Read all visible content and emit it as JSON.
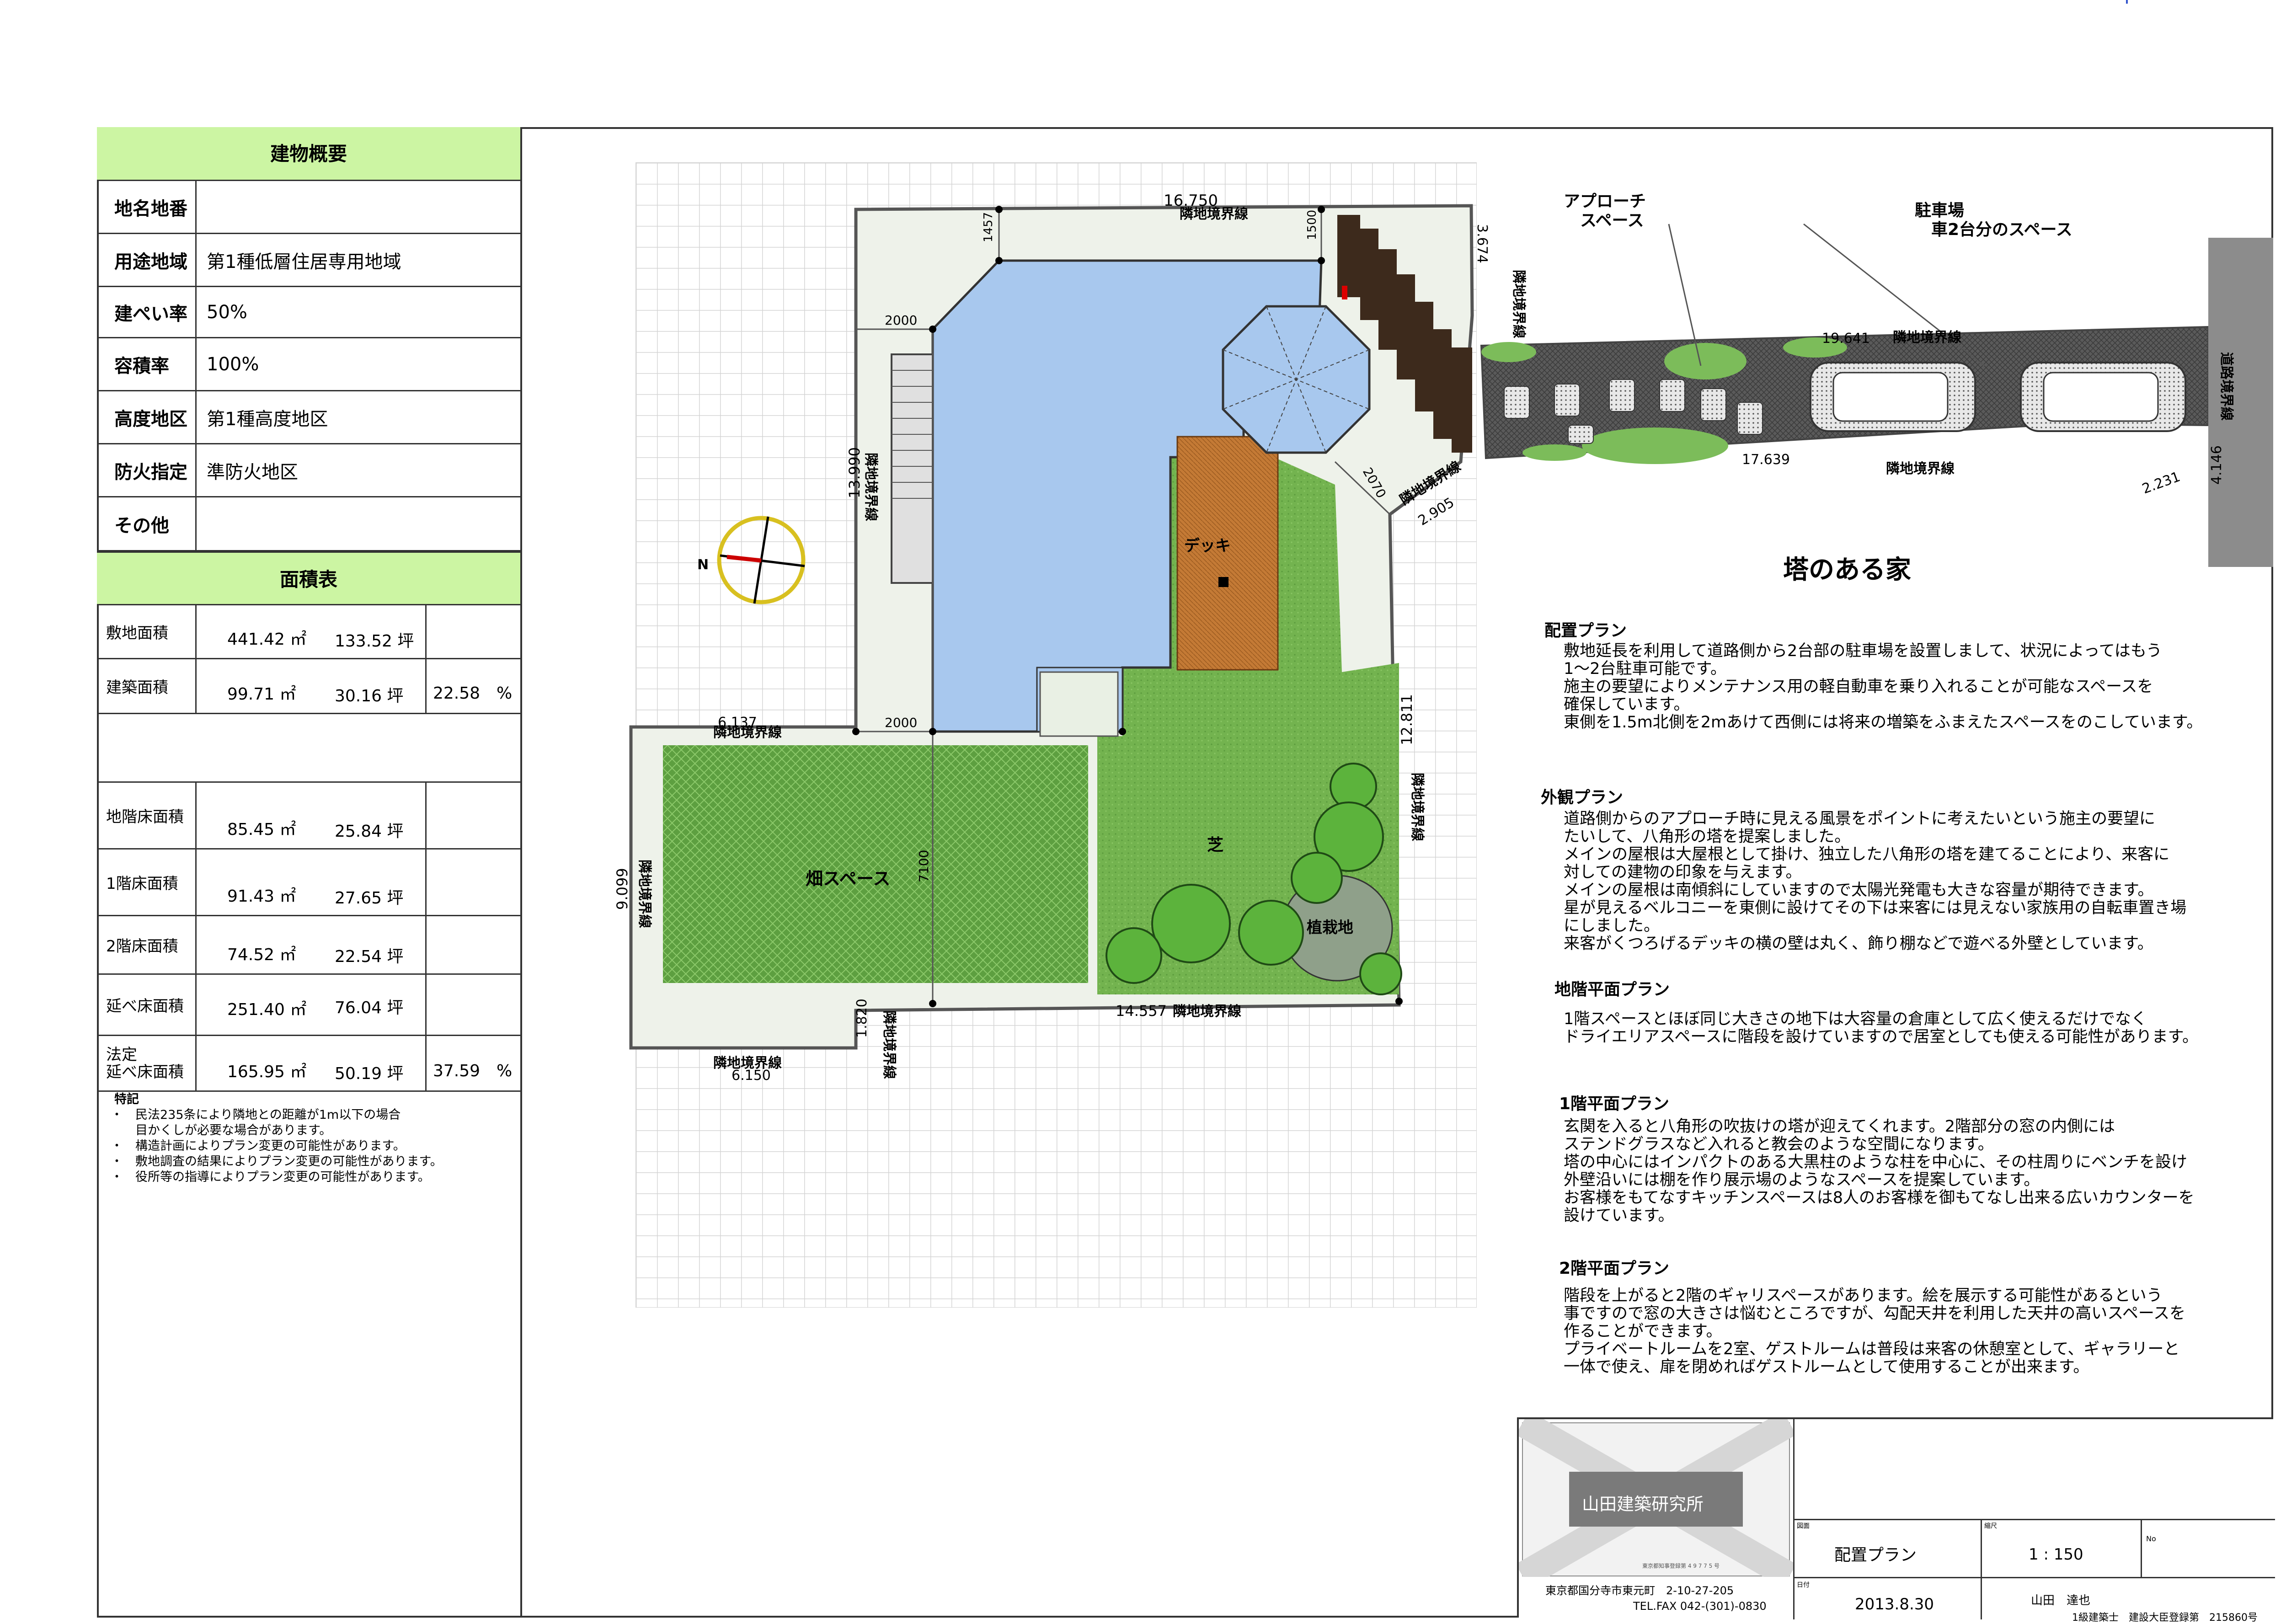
{
  "building": {
    "header": "建物概要",
    "rows": [
      {
        "label": "地名地番",
        "value": ""
      },
      {
        "label": "用途地域",
        "value": "第1種低層住居専用地域"
      },
      {
        "label": "建ぺい率",
        "value": "50%"
      },
      {
        "label": "容積率",
        "value": "100%"
      },
      {
        "label": "高度地区",
        "value": "第1種高度地区"
      },
      {
        "label": "防火指定",
        "value": "準防火地区"
      },
      {
        "label": "その他",
        "value": ""
      }
    ]
  },
  "area": {
    "header": "面積表",
    "rows": [
      {
        "label": "敷地面積",
        "m2": "441.42 ㎡",
        "tsubo": "133.52 坪",
        "ratio": ""
      },
      {
        "label": "建築面積",
        "m2": "99.71 ㎡",
        "tsubo": "30.16 坪",
        "ratio": "22.58　%"
      },
      {
        "label": "",
        "m2": "",
        "tsubo": "",
        "ratio": ""
      },
      {
        "label": "地階床面積",
        "m2": "85.45 ㎡",
        "tsubo": "25.84 坪",
        "ratio": ""
      },
      {
        "label": "1階床面積",
        "m2": "91.43 ㎡",
        "tsubo": "27.65 坪",
        "ratio": ""
      },
      {
        "label": "2階床面積",
        "m2": "74.52 ㎡",
        "tsubo": "22.54 坪",
        "ratio": ""
      },
      {
        "label": "延べ床面積",
        "m2": "251.40 ㎡",
        "tsubo": "76.04 坪",
        "ratio": ""
      },
      {
        "label": "法定\n延べ床面積",
        "m2": "165.95 ㎡",
        "tsubo": "50.19 坪",
        "ratio": "37.59　%"
      }
    ]
  },
  "notes": {
    "title": "特記",
    "items": [
      "・　民法235条により隣地との距離が1m以下の場合",
      "　　目かくしが必要な場合があります。",
      "・　構造計画によりプラン変更の可能性があります。",
      "・　敷地調査の結果によりプラン変更の可能性があります。",
      "・　役所等の指導によりプラン変更の可能性があります。"
    ]
  },
  "plan": {
    "title": "塔のある家",
    "labels": {
      "approach": "アプローチ\n　スペース",
      "parking": "駐車場\n　車2台分のスペース",
      "deck": "デッキ",
      "lawn": "芝",
      "field": "畑スペース",
      "planting": "植栽地",
      "boundary": "隣地境界線",
      "road_boundary": "道路境界線",
      "compass_n": "N"
    },
    "dims": {
      "top": "16.750",
      "left": "13.990",
      "right": "12.811",
      "bottom": "14.557",
      "west_top": "6.137",
      "west_side": "9.099",
      "west_bottom": "6.150",
      "step": "1.820",
      "right_top": "3.674",
      "diag": "2.905",
      "drive_top": "19.641",
      "drive_bottom": "17.639",
      "road": "4.146",
      "corner": "2.231",
      "d2000a": "2000",
      "d2000b": "2000",
      "d1457": "1457",
      "d1500": "1500",
      "d2070": "2070",
      "d7100": "7100"
    }
  },
  "sections": [
    {
      "title": "配置プラン",
      "lines": [
        "敷地延長を利用して道路側から2台部の駐車場を設置しまして、状況によってはもう",
        "1～2台駐車可能です。",
        "施主の要望によりメンテナンス用の軽自動車を乗り入れることが可能なスペースを",
        "確保しています。",
        "東側を1.5m北側を2mあけて西側には将来の増築をふまえたスペースをのこしています。"
      ]
    },
    {
      "title": "外観プラン",
      "lines": [
        "道路側からのアプローチ時に見える風景をポイントに考えたいという施主の要望に",
        "たいして、八角形の塔を提案しました。",
        "メインの屋根は大屋根として掛け、独立した八角形の塔を建てることにより、来客に",
        "対しての建物の印象を与えます。",
        "メインの屋根は南傾斜にしていますので太陽光発電も大きな容量が期待できます。",
        "星が見えるベルコニーを東側に設けてその下は来客には見えない家族用の自転車置き場",
        "にしました。",
        "来客がくつろげるデッキの横の壁は丸く、飾り棚などで遊べる外壁としています。"
      ]
    },
    {
      "title": "地階平面プラン",
      "lines": [
        "1階スペースとほぼ同じ大きさの地下は大容量の倉庫として広く使えるだけでなく",
        "ドライエリアスペースに階段を設けていますので居室としても使える可能性があります。"
      ]
    },
    {
      "title": "1階平面プラン",
      "lines": [
        "玄関を入ると八角形の吹抜けの塔が迎えてくれます。2階部分の窓の内側には",
        "ステンドグラスなど入れると教会のような空間になります。",
        "塔の中心にはインパクトのある大黒柱のような柱を中心に、その柱周りにベンチを設け",
        "外壁沿いには棚を作り展示場のようなスペースを提案しています。",
        "お客様をもてなすキッチンスペースは8人のお客様を御もてなし出来る広いカウンターを",
        "設けています。"
      ]
    },
    {
      "title": "2階平面プラン",
      "lines": [
        "階段を上がると2階のギャリスペースがあります。絵を展示する可能性があるという",
        "事ですので窓の大きさは悩むところですが、勾配天井を利用した天井の高いスペースを",
        "作ることができます。",
        "プライベートルームを2室、ゲストルームは普段は来客の休憩室として、ギャラリーと",
        "一体で使え、扉を閉めればゲストルームとして使用することが出来ます。"
      ]
    }
  ],
  "titleblock": {
    "office": "山田建築研究所",
    "office_sub": "東京都知事登録第 4 9 7 7 5 号",
    "address": "東京都国分寺市東元町　2-10-27-205",
    "tel": "TEL.FAX 042-(301)-0830",
    "drawing_label": "図面",
    "drawing": "配置プラン",
    "scale_label": "縮尺",
    "scale": "1 : 150",
    "no_label": "No",
    "date_label": "日付",
    "date": "2013.8.30",
    "designer": "山田　達也",
    "license": "1級建築士　建設大臣登録第　215860号"
  },
  "colors": {
    "header_bg": "#ccf5a3",
    "building": "#a8c8ee",
    "deck": "#c07a36",
    "lawn": "#6fb24e",
    "field": "#5c9e3e",
    "paving": "#555555",
    "site": "#eef2ea"
  }
}
